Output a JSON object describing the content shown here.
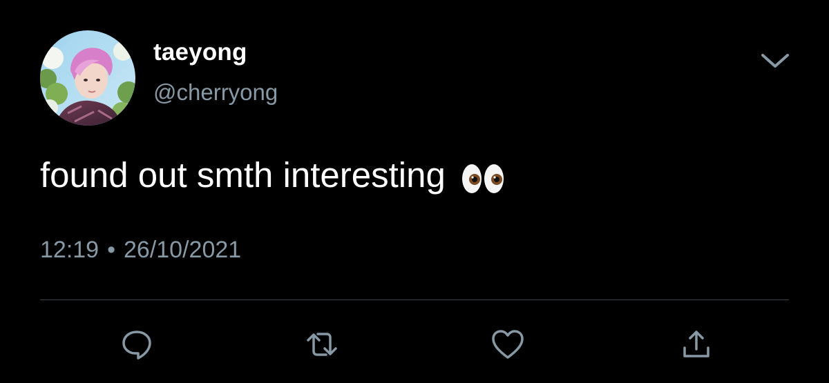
{
  "tweet": {
    "display_name": "taeyong",
    "handle": "@cherryong",
    "text": "found out smth interesting",
    "emoji": "eyes-emoji",
    "time": "12:19",
    "separator": "•",
    "date": "26/10/2021"
  },
  "icons": {
    "more": "chevron-down-icon",
    "reply": "reply-icon",
    "retweet": "retweet-icon",
    "like": "heart-icon",
    "share": "share-icon"
  },
  "colors": {
    "background": "#000000",
    "text": "#ffffff",
    "secondary_text": "#8899a6",
    "divider": "#38444d",
    "icon": "#8899a6"
  }
}
